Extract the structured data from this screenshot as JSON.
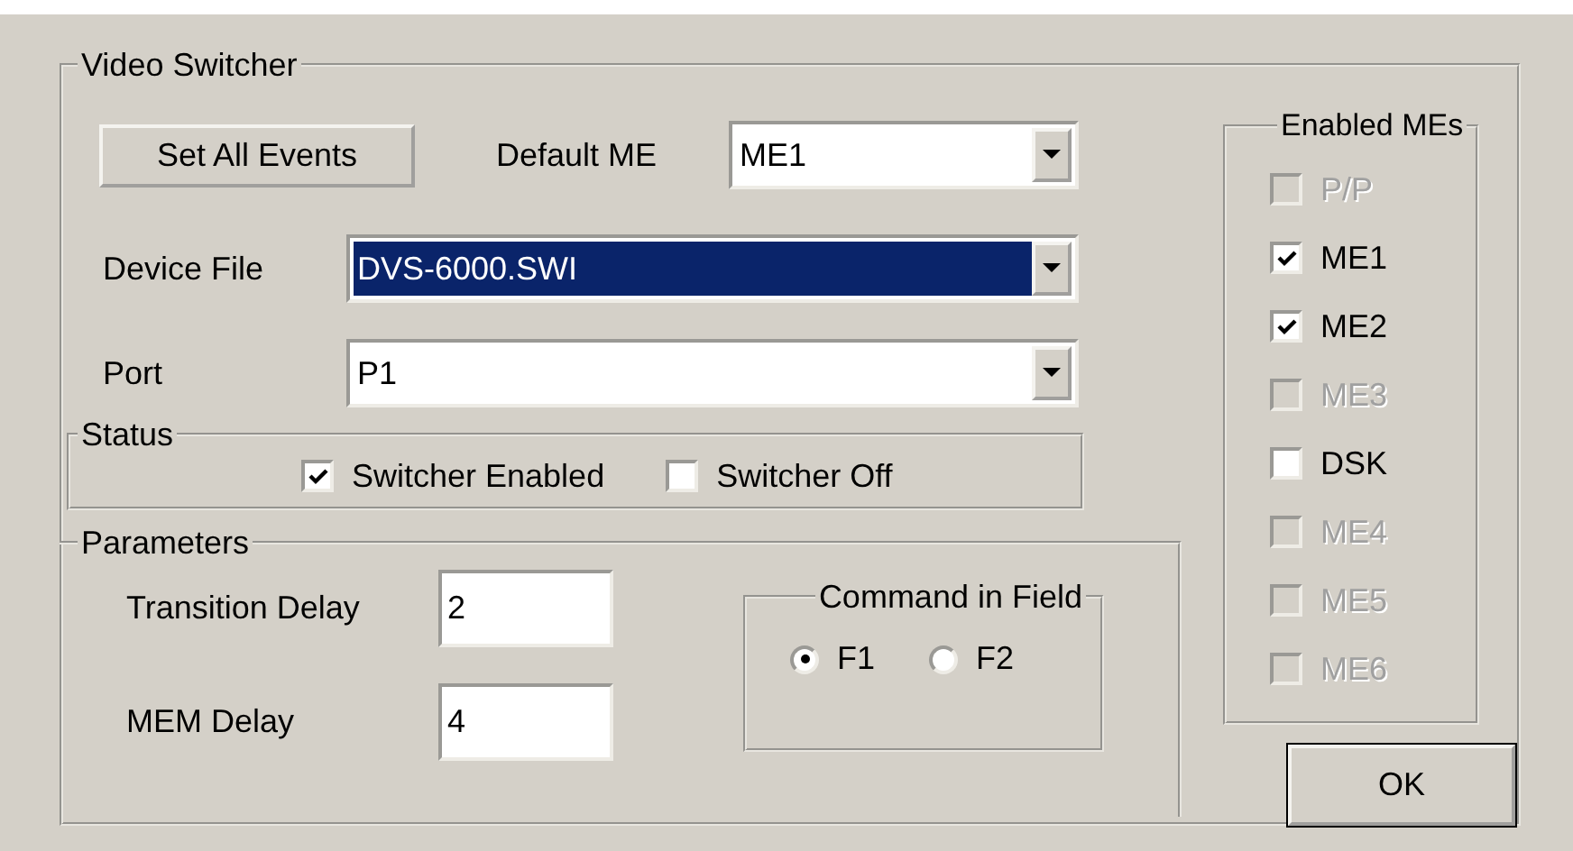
{
  "group": {
    "title": "Video Switcher"
  },
  "set_all_button": "Set All Events",
  "default_me": {
    "label": "Default ME",
    "value": "ME1",
    "selected": false
  },
  "device_file": {
    "label": "Device File",
    "value": "DVS-6000.SWI",
    "selected": true
  },
  "port": {
    "label": "Port",
    "value": "P1",
    "selected": false
  },
  "status": {
    "title": "Status",
    "options": [
      {
        "label": "Switcher Enabled",
        "checked": true
      },
      {
        "label": "Switcher Off",
        "checked": false
      }
    ]
  },
  "parameters": {
    "title": "Parameters",
    "fields": [
      {
        "label": "Transition Delay",
        "value": "2"
      },
      {
        "label": "MEM Delay",
        "value": "4"
      }
    ],
    "command_in_field": {
      "title": "Command in Field",
      "options": [
        {
          "label": "F1",
          "selected": true
        },
        {
          "label": "F2",
          "selected": false
        }
      ]
    }
  },
  "enabled_mes": {
    "title": "Enabled MEs",
    "items": [
      {
        "label": "P/P",
        "checked": false,
        "disabled": true
      },
      {
        "label": "ME1",
        "checked": true,
        "disabled": false
      },
      {
        "label": "ME2",
        "checked": true,
        "disabled": false
      },
      {
        "label": "ME3",
        "checked": false,
        "disabled": true
      },
      {
        "label": "DSK",
        "checked": false,
        "disabled": false
      },
      {
        "label": "ME4",
        "checked": false,
        "disabled": true
      },
      {
        "label": "ME5",
        "checked": false,
        "disabled": true
      },
      {
        "label": "ME6",
        "checked": false,
        "disabled": true
      }
    ]
  },
  "ok_button": "OK"
}
